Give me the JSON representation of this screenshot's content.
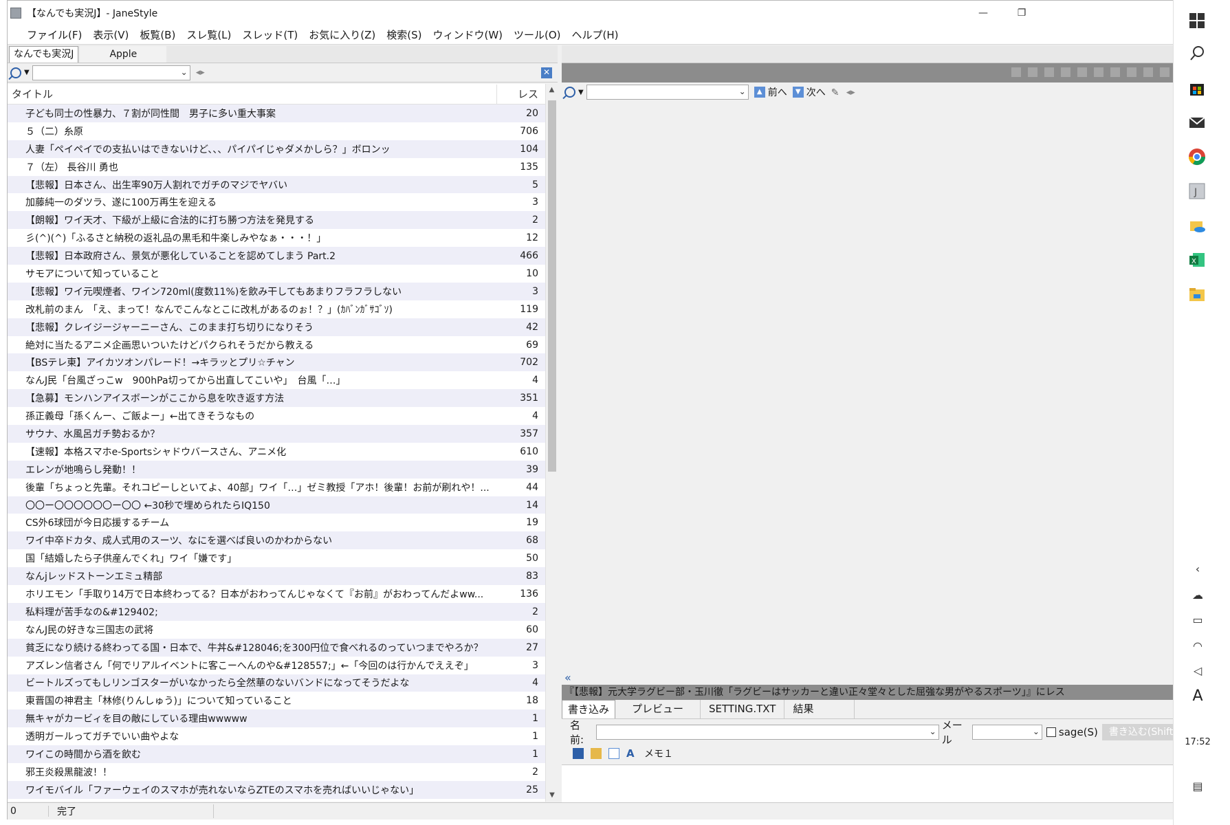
{
  "window": {
    "title": "【なんでも実況J】- JaneStyle",
    "minimize": "—",
    "restore": "❐"
  },
  "menu": [
    "ファイル(F)",
    "表示(V)",
    "板覧(B)",
    "スレ覧(L)",
    "スレッド(T)",
    "お気に入り(Z)",
    "検索(S)",
    "ウィンドウ(W)",
    "ツール(O)",
    "ヘルプ(H)"
  ],
  "board_tabs": [
    "なんでも実況J",
    "Apple"
  ],
  "thread_list": {
    "col_title": "タイトル",
    "col_res": "レス",
    "rows": [
      {
        "title": "子ども同士の性暴力、７割が同性間　男子に多い重大事案",
        "res": "20"
      },
      {
        "title": "５（二）糸原",
        "res": "706"
      },
      {
        "title": "人妻「ペイペイでの支払いはできないけど、、、パイパイじゃダメかしら？」ボロンッ",
        "res": "104"
      },
      {
        "title": "７（左） 長谷川 勇也",
        "res": "135"
      },
      {
        "title": "【悲報】日本さん、出生率90万人割れでガチのマジでヤバい",
        "res": "5"
      },
      {
        "title": "加藤純一のダツラ、遂に100万再生を迎える",
        "res": "3"
      },
      {
        "title": "【朗報】ワイ天才、下級が上級に合法的に打ち勝つ方法を発見する",
        "res": "2"
      },
      {
        "title": "彡(^)(^)「ふるさと納税の返礼品の黒毛和牛楽しみやなぁ・・・！」",
        "res": "12"
      },
      {
        "title": "【悲報】日本政府さん、景気が悪化していることを認めてしまう Part.2",
        "res": "466"
      },
      {
        "title": "サモアについて知っていること",
        "res": "10"
      },
      {
        "title": "【悲報】ワイ元喫煙者、ワイン720ml(度数11%)を飲み干してもあまりフラフラしない",
        "res": "3"
      },
      {
        "title": "改札前のまん　「え、まって！なんでこんなとこに改札があるのぉ！？」(ｶﾊﾞﾝｶﾞｻｺﾞｿ)",
        "res": "119"
      },
      {
        "title": "【悲報】クレイジージャーニーさん、このまま打ち切りになりそう",
        "res": "42"
      },
      {
        "title": "絶対に当たるアニメ企画思いついたけどパクられそうだから教える",
        "res": "69"
      },
      {
        "title": "【BSテレ東】アイカツオンパレード！→キラッとプリ☆チャン",
        "res": "702"
      },
      {
        "title": "なんJ民「台風ざっこw　900hPa切ってから出直してこいや」　台風「…」",
        "res": "4"
      },
      {
        "title": "【急募】モンハンアイスボーンがここから息を吹き返す方法",
        "res": "351"
      },
      {
        "title": "孫正義母「孫くんー、ご飯よー」←出てきそうなもの",
        "res": "4"
      },
      {
        "title": "サウナ、水風呂ガチ勢おるか？",
        "res": "357"
      },
      {
        "title": "【速報】本格スマホe-Sportsシャドウバースさん、アニメ化",
        "res": "610"
      },
      {
        "title": "エレンが地鳴らし発動！！",
        "res": "39"
      },
      {
        "title": "後輩「ちょっと先輩。それコピーしといてよ、40部」ワイ「…」ゼミ教授「アホ！後輩！お前が刷れや！...",
        "res": "44"
      },
      {
        "title": "〇〇ー〇〇〇〇〇〇ー〇〇 ←30秒で埋められたらIQ150",
        "res": "14"
      },
      {
        "title": "CS外6球団が今日応援するチーム",
        "res": "19"
      },
      {
        "title": "ワイ中卒ドカタ、成人式用のスーツ、なにを選べば良いのかわからない",
        "res": "68"
      },
      {
        "title": "国「結婚したら子供産んでくれ」ワイ「嫌です」",
        "res": "50"
      },
      {
        "title": "なんjレッドストーンエミュ精部",
        "res": "83"
      },
      {
        "title": "ホリエモン「手取り14万で日本終わってる？日本がおわってんじゃなくて『お前』がおわってんだよww...",
        "res": "136"
      },
      {
        "title": "私料理が苦手なの&#129402;",
        "res": "2"
      },
      {
        "title": "なんJ民の好きな三国志の武将",
        "res": "60"
      },
      {
        "title": "貧乏になり続ける終わってる国・日本で、牛丼&#128046;を300円位で食べれるのっていつまでやろか？",
        "res": "27"
      },
      {
        "title": "アズレン信者さん「何でリアルイベントに客こーへんのや&#128557;」←「今回のは行かんでええぞ」",
        "res": "3"
      },
      {
        "title": "ビートルズってもしリンゴスターがいなかったら全然華のないバンドになってそうだよな",
        "res": "4"
      },
      {
        "title": "東晋国の神君主「林修(りんしゅう)」について知っていること",
        "res": "18"
      },
      {
        "title": "無キャがカービィを目の敵にしている理由wwwww",
        "res": "1"
      },
      {
        "title": "透明ガールってガチでいい曲やよな",
        "res": "1"
      },
      {
        "title": "ワイこの時間から酒を飲む",
        "res": "1"
      },
      {
        "title": "邪王炎殺黒龍波！！",
        "res": "2"
      },
      {
        "title": "ワイモバイル「ファーウェイのスマホが売れないならZTEのスマホを売ればいいじゃない」",
        "res": "25"
      }
    ]
  },
  "right": {
    "prev_label": "前へ",
    "next_label": "次へ",
    "collapse_glyph": "«",
    "reply_target": "『【悲報】元大学ラグビー部・玉川徹「ラグビーはサッカーと違い正々堂々とした屈強な男がやるスポーツ」』にレス",
    "write_tabs": [
      "書き込み",
      "プレビュー",
      "SETTING.TXT",
      "結果"
    ],
    "name_label": "名前:",
    "mail_label": "メール",
    "sage_label": "sage(S)",
    "post_label": "書き込む(Shift",
    "memo_label": "メモ１"
  },
  "status": {
    "count": "0",
    "message": "完了"
  },
  "taskbar": {
    "ime": "A",
    "clock": "17:52"
  },
  "colors": {
    "row_alt": "#eeeef8",
    "toolbar_gray": "#8c8c8c",
    "accent_blue": "#2d5fa8"
  }
}
